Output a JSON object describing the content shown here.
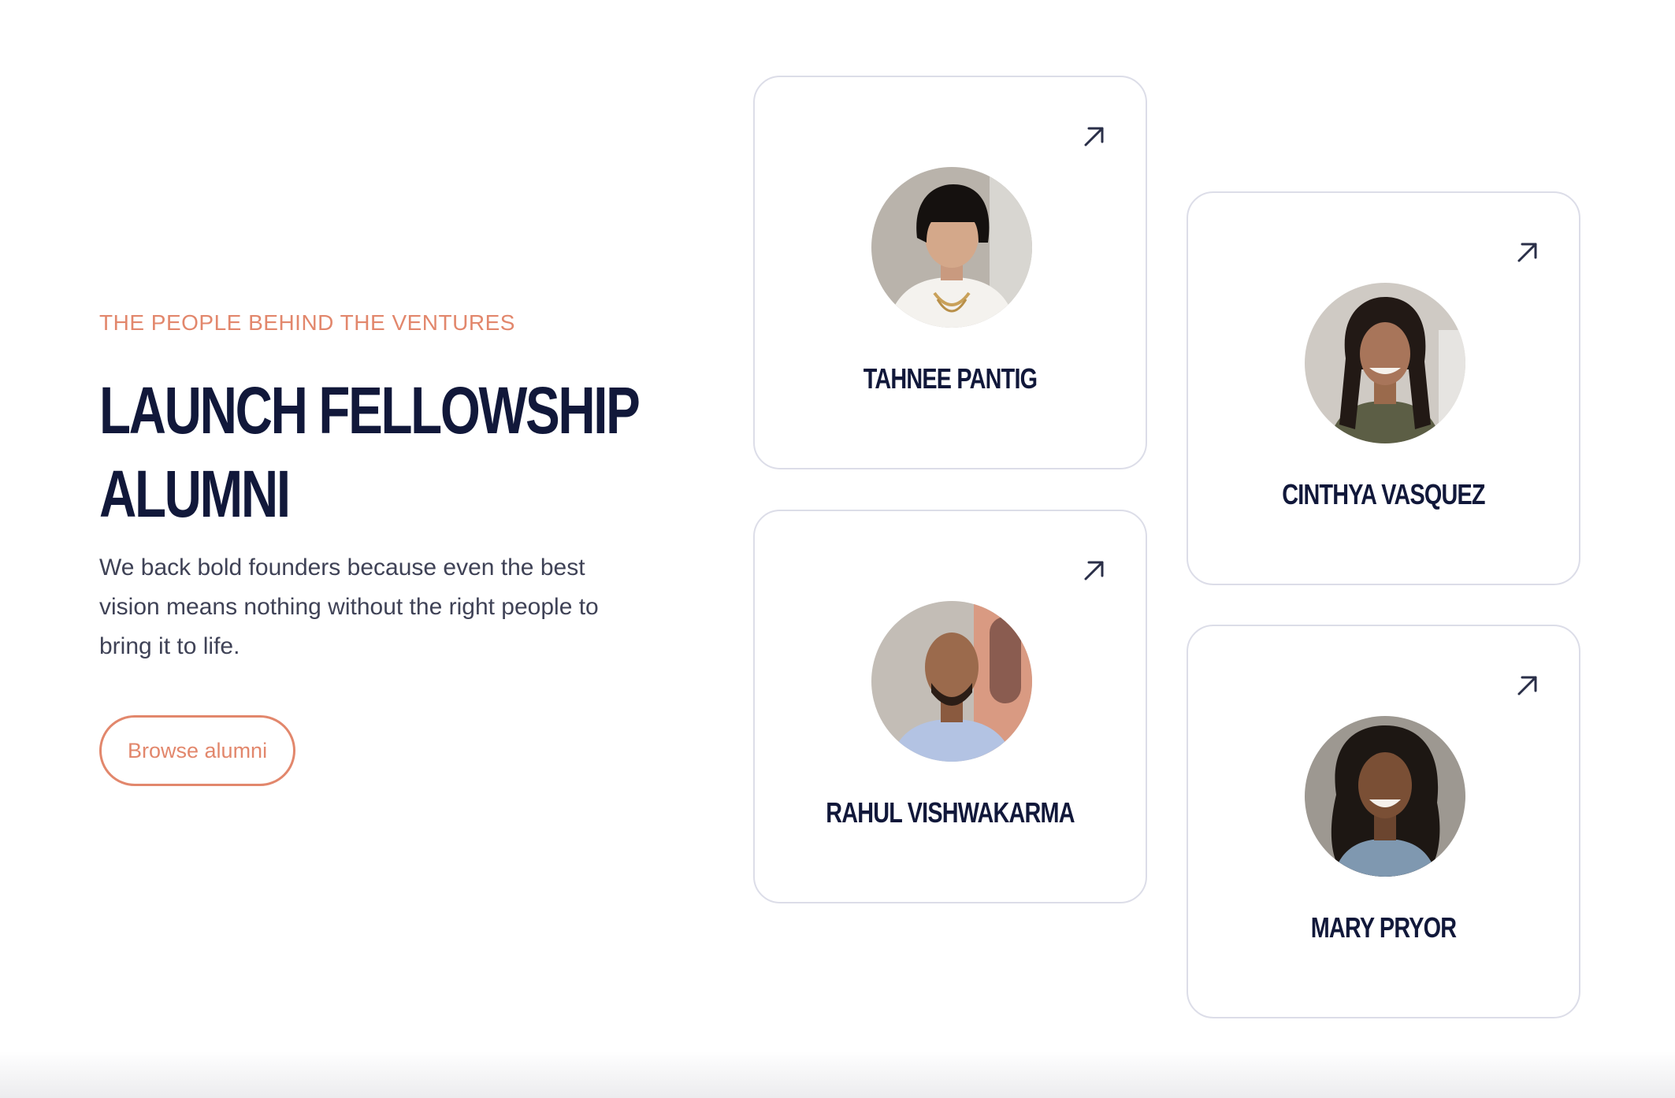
{
  "section": {
    "eyebrow": "THE PEOPLE BEHIND THE VENTURES",
    "headline_line1": "LAUNCH FELLOWSHIP",
    "headline_line2": "ALUMNI",
    "description": "We back bold founders because even the best vision means nothing without the right people to bring it to life.",
    "cta_label": "Browse alumni"
  },
  "alumni": [
    {
      "name": "TAHNEE PANTIG",
      "icon": "arrow-up-right-icon"
    },
    {
      "name": "CINTHYA VASQUEZ",
      "icon": "arrow-up-right-icon"
    },
    {
      "name": "RAHUL VISHWAKARMA",
      "icon": "arrow-up-right-icon"
    },
    {
      "name": "MARY PRYOR",
      "icon": "arrow-up-right-icon"
    }
  ],
  "colors": {
    "accent": "#e2876c",
    "heading": "#11183a",
    "body_text": "#3f4256",
    "card_border": "#dcdde8"
  }
}
